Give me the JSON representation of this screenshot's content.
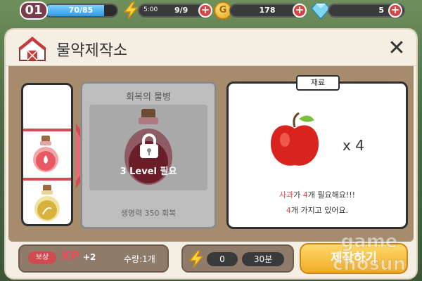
{
  "hud": {
    "level": "01",
    "xp_text": "70/85",
    "xp_progress": 0.82,
    "energy_timer": "5:00",
    "energy_count": "9/9",
    "coins": "178",
    "gems": "5",
    "plus_label": "+"
  },
  "modal": {
    "title": "물약제작소",
    "close_label": "✕",
    "recipes": [
      {
        "icon": "red-potion-icon",
        "selected": true
      },
      {
        "icon": "yellow-potion-icon",
        "selected": false
      }
    ],
    "item": {
      "name": "회복의 물병",
      "lock_text": "3 Level 필요",
      "effect": "생명력 350 회복"
    },
    "materials": {
      "tab_label": "재료",
      "quantity": "x 4",
      "need_prefix": "사과",
      "need_mid": "가 ",
      "need_count": "4",
      "need_suffix": "개 필요해요!!!",
      "have_count": "4",
      "have_suffix": "개 가지고 있어요."
    },
    "footer": {
      "reward_badge": "보상",
      "xp_label": "XP",
      "xp_amount": "+2",
      "quantity_label": "수량:1개",
      "energy_cost": "0",
      "time_cost": "30분",
      "craft_label": "제작하기"
    }
  },
  "watermark": {
    "line1": "game",
    "line2": "chosun"
  },
  "colors": {
    "accent_red": "#d64a52",
    "craft_button": "#f0ac28",
    "panel_brown": "#a68c6c"
  }
}
